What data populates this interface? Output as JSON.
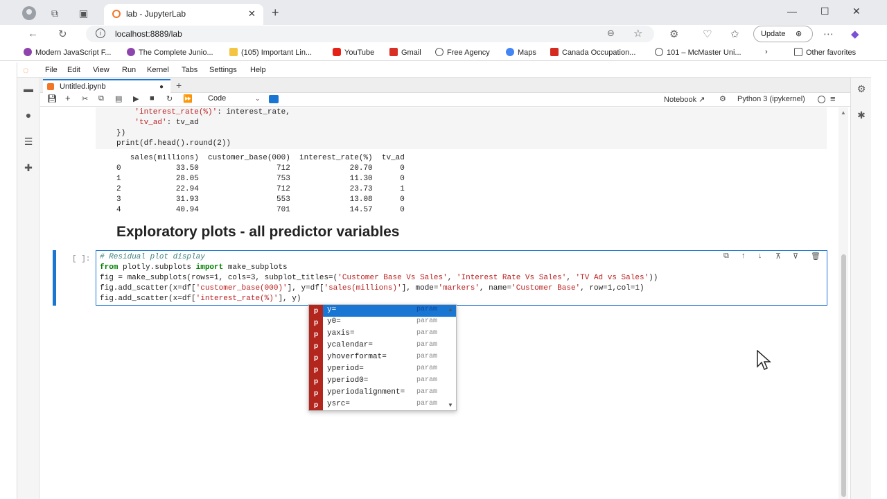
{
  "browser": {
    "tab_title": "lab - JupyterLab",
    "url": "localhost:8889/lab",
    "update_label": "Update",
    "bookmarks": [
      "Modern JavaScript F...",
      "The Complete Junio...",
      "(105) Important Lin...",
      "YouTube",
      "Gmail",
      "Free Agency",
      "Maps",
      "Canada Occupation...",
      "101 – McMaster Uni..."
    ],
    "other_favorites": "Other favorites"
  },
  "jupyter": {
    "menu": [
      "File",
      "Edit",
      "View",
      "Run",
      "Kernel",
      "Tabs",
      "Settings",
      "Help"
    ],
    "notebook_tab": "Untitled.ipynb",
    "cell_type": "Code",
    "notebook_label": "Notebook",
    "kernel": "Python 3 (ipykernel)"
  },
  "cell1": {
    "lines": [
      "    'interest_rate(%)': interest_rate,",
      "    'tv_ad': tv_ad",
      "})",
      "print(df.head().round(2))"
    ]
  },
  "output": {
    "lines": [
      "   sales(millions)  customer_base(000)  interest_rate(%)  tv_ad",
      "0            33.50                 712             20.70      0",
      "1            28.05                 753             11.30      0",
      "2            22.94                 712             23.73      1",
      "3            31.93                 553             13.08      0",
      "4            40.94                 701             14.57      0"
    ]
  },
  "heading": "Exploratory plots - all predictor variables",
  "cell2": {
    "prompt": "[ ]:",
    "lines": [
      "# Residual plot display",
      "from plotly.subplots import make_subplots",
      "fig = make_subplots(rows=1, cols=3, subplot_titles=('Customer Base Vs Sales', 'Interest Rate Vs Sales', 'TV Ad vs Sales'))",
      "fig.add_scatter(x=df['customer_base(000)'], y=df['sales(millions)'], mode='markers', name='Customer Base', row=1,col=1)",
      "fig.add_scatter(x=df['interest_rate(%)'], y)"
    ]
  },
  "completer": {
    "items": [
      {
        "badge": "p",
        "label": "y=",
        "type": "param"
      },
      {
        "badge": "p",
        "label": "y0=",
        "type": "param"
      },
      {
        "badge": "p",
        "label": "yaxis=",
        "type": "param"
      },
      {
        "badge": "p",
        "label": "ycalendar=",
        "type": "param"
      },
      {
        "badge": "p",
        "label": "yhoverformat=",
        "type": "param"
      },
      {
        "badge": "p",
        "label": "yperiod=",
        "type": "param"
      },
      {
        "badge": "p",
        "label": "yperiod0=",
        "type": "param"
      },
      {
        "badge": "p",
        "label": "yperiodalignment=",
        "type": "param"
      },
      {
        "badge": "p",
        "label": "ysrc=",
        "type": "param"
      }
    ]
  }
}
